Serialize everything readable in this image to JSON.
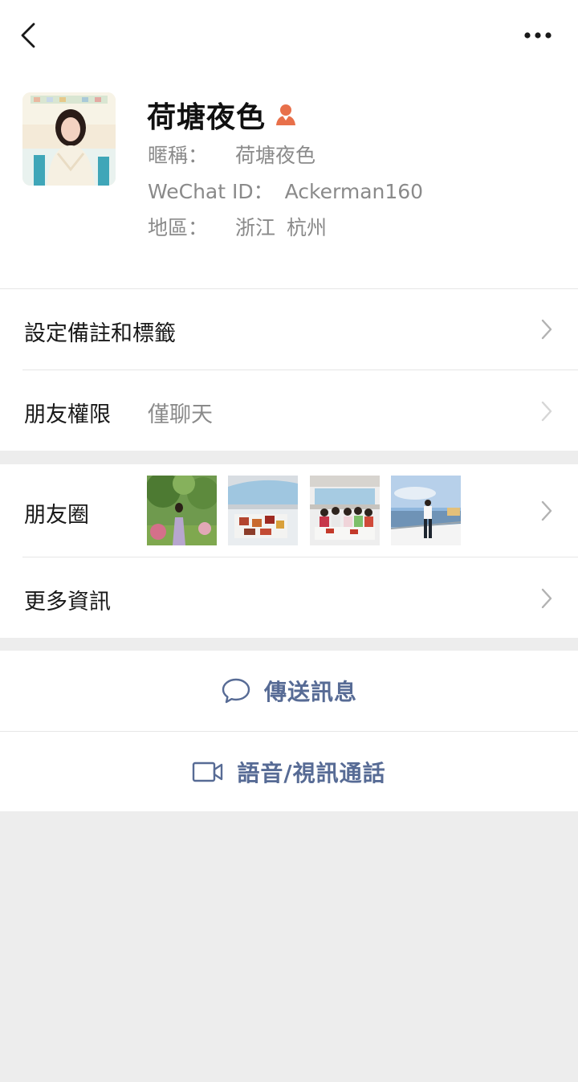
{
  "profile": {
    "name": "荷塘夜色",
    "gender_icon": "female-user-icon",
    "nickname_label": "暱稱：",
    "nickname": "荷塘夜色",
    "wechat_id_label": "WeChat ID：",
    "wechat_id": "Ackerman160",
    "region_label": "地區：",
    "region_province": "浙江",
    "region_city": "杭州"
  },
  "menu": {
    "remarks_tags": "設定備註和標籤",
    "friend_permissions_label": "朋友權限",
    "friend_permissions_value": "僅聊天",
    "moments_label": "朋友圈",
    "more_info": "更多資訊"
  },
  "actions": {
    "send_message": "傳送訊息",
    "voice_video_call": "語音/視訊通話"
  },
  "icons": {
    "back": "chevron-left-icon",
    "more": "more-dots-icon",
    "row_arrow": "chevron-right-icon",
    "message": "chat-bubble-icon",
    "video": "video-camera-icon"
  },
  "colors": {
    "link_blue": "#576b95",
    "gender_orange": "#e8704a",
    "secondary_text": "#8a8a8a",
    "background_gray": "#ededed"
  }
}
